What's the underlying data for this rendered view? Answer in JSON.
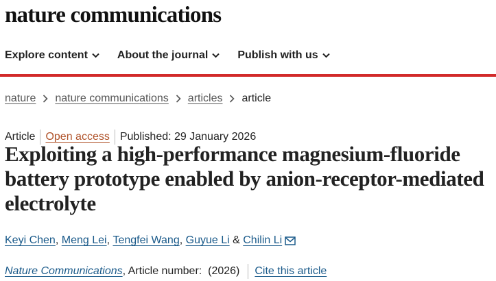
{
  "brand": {
    "name": "nature communications"
  },
  "nav": {
    "items": [
      {
        "label": "Explore content"
      },
      {
        "label": "About the journal"
      },
      {
        "label": "Publish with us"
      }
    ]
  },
  "colors": {
    "accent_bar": "#d22a2a",
    "link": "#1a5a8a",
    "open_access": "#b0532a"
  },
  "breadcrumb": {
    "items": [
      "nature",
      "nature communications",
      "articles"
    ],
    "current": "article"
  },
  "article": {
    "type": "Article",
    "access": "Open access",
    "published": "Published: 29 January 2026",
    "title": "Exploiting a high-performance magnesium-fluoride battery prototype enabled by anion-receptor-mediated electrolyte",
    "authors": [
      "Keyi Chen",
      "Meng Lei",
      "Tengfei Wang",
      "Guyue Li",
      "Chilin Li"
    ],
    "author_sep": ",",
    "author_last_sep": "&",
    "journal": "Nature Communications",
    "article_number": ", Article number:  (2026)",
    "cite_label": "Cite this article"
  }
}
